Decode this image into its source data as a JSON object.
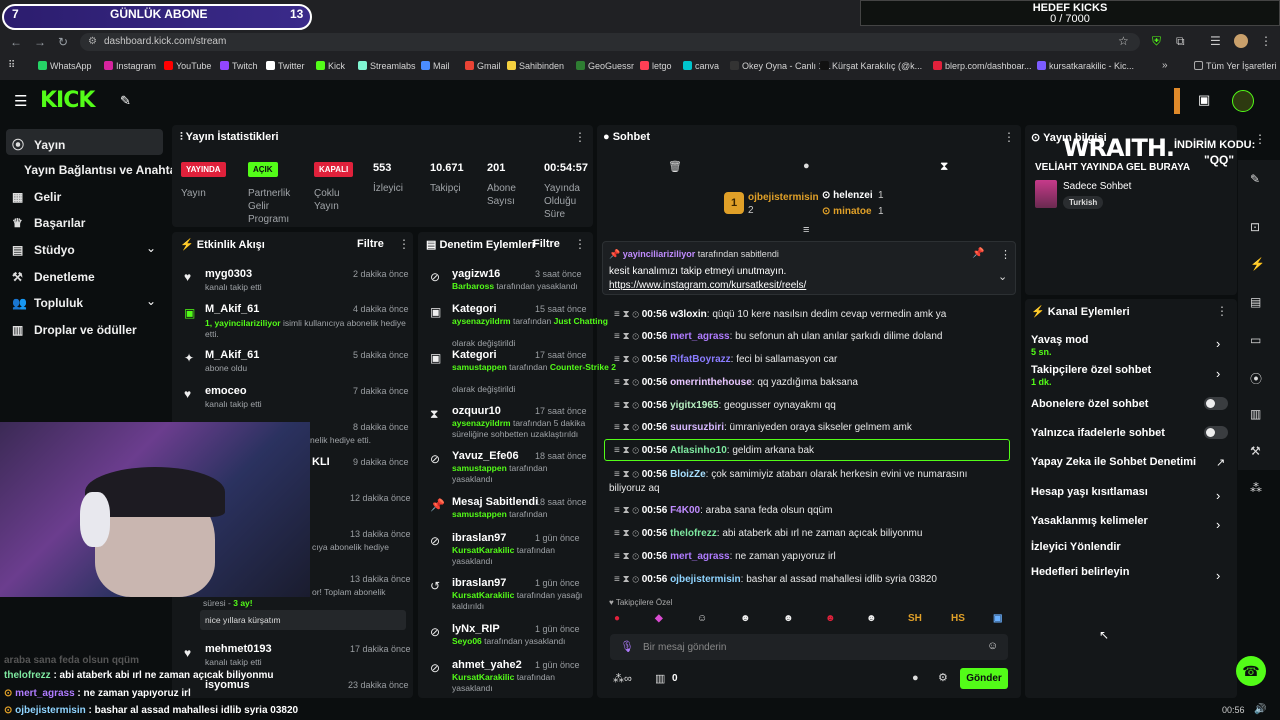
{
  "overlay_sub": {
    "left": "7",
    "title": "GÜNLÜK ABONE",
    "right": "13"
  },
  "overlay_kicks": {
    "title": "HEDEF KICKS",
    "value": "0 / 7000"
  },
  "browser": {
    "url": "dashboard.kick.com/stream",
    "all_bookmarks": "Tüm Yer İşaretleri",
    "bookmarks": [
      "WhatsApp",
      "Instagram",
      "YouTube",
      "Twitch",
      "Twitter",
      "Kick",
      "Streamlabs",
      "Mail",
      "Gmail",
      "Sahibinden",
      "GeoGuessr",
      "letgo",
      "canva",
      "Okey Oyna - Canlı 1...",
      "Kürşat Karakılıç (@k...",
      "blerp.com/dashboar...",
      "kursatkarakilic - Kic..."
    ]
  },
  "sidebar": {
    "items": [
      "Yayın",
      "Yayın Bağlantısı ve Anahtarı",
      "Gelir",
      "Başarılar",
      "Stüdyo",
      "Denetleme",
      "Topluluk",
      "Droplar ve ödüller"
    ]
  },
  "stats": {
    "title": "Yayın İstatistikleri",
    "cols": [
      {
        "badge": "YAYINDA",
        "label": "Yayın",
        "color": "#e0213b"
      },
      {
        "badge": "AÇIK",
        "label": "Partnerlik Gelir Programı",
        "color": "#53fc18"
      },
      {
        "badge": "KAPALI",
        "label": "Çoklu Yayın",
        "color": "#e0213b"
      },
      {
        "value": "553",
        "label": "İzleyici"
      },
      {
        "value": "10.671",
        "label": "Takipçi"
      },
      {
        "value": "201",
        "label": "Abone Sayısı"
      },
      {
        "value": "00:54:57",
        "label": "Yayında Olduğu Süre"
      }
    ]
  },
  "activity": {
    "title": "Etkinlik Akışı",
    "filter": "Filtre",
    "items": [
      {
        "name": "myg0303",
        "time": "2 dakika önce",
        "sub": "kanalı takip etti"
      },
      {
        "name": "M_Akif_61",
        "time": "4 dakika önce",
        "sub1": "1, yayincilariziliyor",
        "sub2": " isimli kullanıcıya abonelik hediye",
        "sub3": "etti."
      },
      {
        "name": "M_Akif_61",
        "time": "5 dakika önce",
        "sub": "abone oldu"
      },
      {
        "name": "emoceo",
        "time": "7 dakika önce",
        "sub": "kanalı takip etti"
      },
      {
        "name": "",
        "time": "8 dakika önce",
        "sub": "nelik hediye etti."
      },
      {
        "name": "KLI",
        "time": "9 dakika önce",
        "sub": ""
      },
      {
        "name": "",
        "time": "12 dakika önce",
        "sub": ""
      },
      {
        "name": "",
        "time": "13 dakika önce",
        "sub": "cıya abonelik hediye"
      },
      {
        "name": "",
        "time": "13 dakika önce",
        "sub": "or! Toplam abonelik"
      },
      {
        "name": "mehmet0193",
        "time": "17 dakika önce",
        "sub": "kanalı takip etti"
      },
      {
        "name": "isyomus",
        "time": "23 dakika önce",
        "sub": ""
      }
    ],
    "resub_duration": "süresi - ",
    "resub_months": "3 ay!",
    "resub_msg": "nice yıllara kürşatım"
  },
  "mod": {
    "title": "Denetim Eylemleri",
    "filter": "Filtre",
    "items": [
      {
        "name": "yagizw16",
        "time": "3 saat önce",
        "user": "Barbaross",
        "rest": " tarafından yasaklandı"
      },
      {
        "name": "Kategori",
        "time": "15 saat önce",
        "user": "aysenazyildrm",
        "rest": " tarafından ",
        "extra": "Just Chatting",
        "extra2": " olarak değiştirildi"
      },
      {
        "name": "Kategori",
        "time": "17 saat önce",
        "user": "samustappen",
        "rest": " tarafından ",
        "extra": "Counter-Strike 2",
        "extra2": " olarak değiştirildi"
      },
      {
        "name": "ozquur10",
        "time": "17 saat önce",
        "user": "aysenazyildrm",
        "rest": " tarafından 5 dakika",
        "extra2": "süreliğine sohbetten uzaklaştırıldı"
      },
      {
        "name": "Yavuz_Efe06",
        "time": "18 saat önce",
        "user": "samustappen",
        "rest": " tarafından",
        "extra2": "yasaklandı"
      },
      {
        "name": "Mesaj Sabitlendi",
        "time": "18 saat önce",
        "user": "samustappen",
        "rest": " tarafından"
      },
      {
        "name": "ibraslan97",
        "time": "1 gün önce",
        "user": "KursatKarakilic",
        "rest": " tarafından",
        "extra2": "yasaklandı"
      },
      {
        "name": "ibraslan97",
        "time": "1 gün önce",
        "user": "KursatKarakilic",
        "rest": " tarafından yasağı",
        "extra2": "kaldırıldı"
      },
      {
        "name": "lyNx_RIP",
        "time": "1 gün önce",
        "user": "Seyo06",
        "rest": " tarafından yasaklandı"
      },
      {
        "name": "ahmet_yahe2",
        "time": "1 gün önce",
        "user": "KursatKarakilic",
        "rest": " tarafından",
        "extra2": "yasaklandı"
      }
    ]
  },
  "chat": {
    "title": "Sohbet",
    "top": [
      {
        "name": "ojbejistermisin",
        "count": "2"
      },
      {
        "name": "helenzei",
        "count": "1"
      },
      {
        "name": "minatoe",
        "count": "1"
      }
    ],
    "pinned_by": "yayinciliariziliyor",
    "pinned_by_rest": " tarafından sabitlendi",
    "pinned_msg": "kesit kanalımızı takip etmeyi unutmayın.",
    "pinned_link": "https://www.instagram.com/kursatkesit/reels/",
    "messages": [
      {
        "time": "00:56",
        "user": "w3loxin",
        "color": "#ffffff",
        "text": "qüqü 10 kere nasılsın dedim cevap vermedin amk ya"
      },
      {
        "time": "00:56",
        "user": "mert_agrass",
        "color": "#b07cff",
        "text": "bu sefonun ah ulan anılar şarkıdı dilime doland"
      },
      {
        "time": "00:56",
        "user": "RifatBoyrazz",
        "color": "#8a7cff",
        "text": "feci bi sallamasyon car"
      },
      {
        "time": "00:56",
        "user": "omerrinthehouse",
        "color": "#e8c6ff",
        "text": "qq yazdığıma baksana"
      },
      {
        "time": "00:56",
        "user": "yigitx1965",
        "color": "#b6f0c0",
        "text": "geogusser oynayakmı qq"
      },
      {
        "time": "00:56",
        "user": "suursuzbiri",
        "color": "#d7b8ff",
        "text": "ümraniyeden oraya sikseler gelmem amk"
      },
      {
        "time": "00:56",
        "user": "Atlasinho10",
        "color": "#7ee8a0",
        "text": "geldim arkana bak"
      },
      {
        "time": "00:56",
        "user": "BloizZe",
        "color": "#a8e0ff",
        "text": "çok samimiyiz atabarı olarak herkesin evini ve numarasını",
        "text2": "biliyoruz aq"
      },
      {
        "time": "00:56",
        "user": "F4K00",
        "color": "#c08cff",
        "text": "araba sana feda olsun qqüm"
      },
      {
        "time": "00:56",
        "user": "thelofrezz",
        "color": "#7ee8a0",
        "text": "abi ataberk abi ırl ne zaman açıcak biliyonmu"
      },
      {
        "time": "00:56",
        "user": "mert_agrass",
        "color": "#b07cff",
        "text": "ne zaman yapıyoruz irl"
      },
      {
        "time": "00:56",
        "user": "ojbejistermisin",
        "color": "#8fd4ff",
        "text": "bashar al assad mahallesi idlib syria 03820"
      }
    ],
    "follower_only": "Takipçilere Özel",
    "input_placeholder": "Bir mesaj gönderin",
    "count": "0",
    "send": "Gönder"
  },
  "stream_info": {
    "title": "Yayın bilgisi",
    "overlay_big": "WRAITH.",
    "overlay_code": "İNDİRİM KODU:",
    "overlay_qq": "\"QQ\"",
    "headline": "VELİAHT YAYINDA GEL BURAYA",
    "category": "Sadece Sohbet",
    "tag": "Turkish"
  },
  "channel": {
    "title": "Kanal Eylemleri",
    "actions": [
      {
        "label": "Yavaş mod",
        "sub": "5 sn.",
        "kind": "chev"
      },
      {
        "label": "Takipçilere özel sohbet",
        "sub": "1 dk.",
        "kind": "chev"
      },
      {
        "label": "Abonelere özel sohbet",
        "kind": "toggle"
      },
      {
        "label": "Yalnızca ifadelerle sohbet",
        "kind": "toggle"
      },
      {
        "label": "Yapay Zeka ile Sohbet Denetimi",
        "kind": "ext"
      },
      {
        "label": "Hesap yaşı kısıtlaması",
        "kind": "chev"
      },
      {
        "label": "Yasaklanmış kelimeler",
        "kind": "chev"
      },
      {
        "label": "İzleyici Yönlendir",
        "kind": "none"
      },
      {
        "label": "Hedefleri belirleyin",
        "kind": "chev"
      }
    ]
  },
  "bottom_overlay": [
    {
      "user": "thelofrezz",
      "color": "#7ee8a0",
      "text": " : abi ataberk abi ırl ne zaman açıcak biliyonmu"
    },
    {
      "user": "mert_agrass",
      "color": "#b07cff",
      "text": " : ne zaman yapıyoruz irl"
    },
    {
      "user": "ojbejistermisin",
      "color": "#8fd4ff",
      "text": " : bashar al assad mahallesi idlib syria 03820"
    }
  ],
  "bottom_faded": "araba sana feda olsun qqüm",
  "taskbar_time": "00:56"
}
